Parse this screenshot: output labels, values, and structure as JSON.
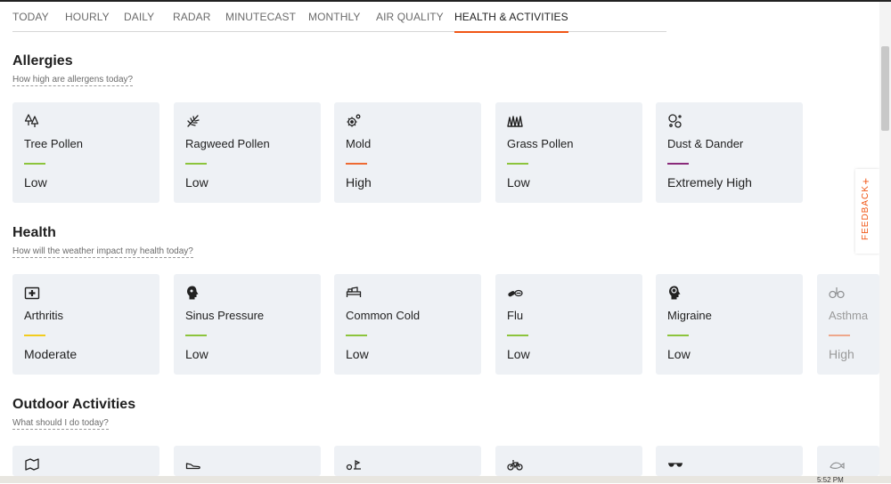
{
  "tabs": [
    {
      "label": "TODAY"
    },
    {
      "label": "HOURLY"
    },
    {
      "label": "DAILY"
    },
    {
      "label": "RADAR"
    },
    {
      "label": "MINUTECAST"
    },
    {
      "label": "MONTHLY"
    },
    {
      "label": "AIR QUALITY"
    },
    {
      "label": "HEALTH & ACTIVITIES",
      "active": true
    }
  ],
  "allergies": {
    "title": "Allergies",
    "subtitle": "How high are allergens today?",
    "cards": [
      {
        "icon": "tree-icon",
        "name": "Tree Pollen",
        "level": "Low",
        "color": "#8cc43c"
      },
      {
        "icon": "ragweed-icon",
        "name": "Ragweed Pollen",
        "level": "Low",
        "color": "#8cc43c"
      },
      {
        "icon": "mold-icon",
        "name": "Mold",
        "level": "High",
        "color": "#ee6a33"
      },
      {
        "icon": "grass-icon",
        "name": "Grass Pollen",
        "level": "Low",
        "color": "#8cc43c"
      },
      {
        "icon": "dust-icon",
        "name": "Dust & Dander",
        "level": "Extremely High",
        "color": "#8a2a7a"
      }
    ]
  },
  "health": {
    "title": "Health",
    "subtitle": "How will the weather impact my health today?",
    "cards": [
      {
        "icon": "first-aid-icon",
        "name": "Arthritis",
        "level": "Moderate",
        "color": "#f2cc1d"
      },
      {
        "icon": "head-profile-icon",
        "name": "Sinus Pressure",
        "level": "Low",
        "color": "#8cc43c"
      },
      {
        "icon": "bed-icon",
        "name": "Common Cold",
        "level": "Low",
        "color": "#8cc43c"
      },
      {
        "icon": "pills-icon",
        "name": "Flu",
        "level": "Low",
        "color": "#8cc43c"
      },
      {
        "icon": "brain-head-icon",
        "name": "Migraine",
        "level": "Low",
        "color": "#8cc43c"
      },
      {
        "icon": "lungs-icon",
        "name": "Asthma",
        "level": "High",
        "color": "#ee6a33",
        "faded": true
      }
    ]
  },
  "outdoor": {
    "title": "Outdoor Activities",
    "subtitle": "What should I do today?",
    "cards": [
      {
        "icon": "map-icon"
      },
      {
        "icon": "running-shoe-icon"
      },
      {
        "icon": "golf-icon"
      },
      {
        "icon": "bicycle-icon"
      },
      {
        "icon": "sunglasses-icon"
      },
      {
        "icon": "fishing-icon",
        "faded": true
      }
    ]
  },
  "feedback": {
    "label": "FEEDBACK",
    "plus": "+"
  },
  "clock": "5:52 PM"
}
